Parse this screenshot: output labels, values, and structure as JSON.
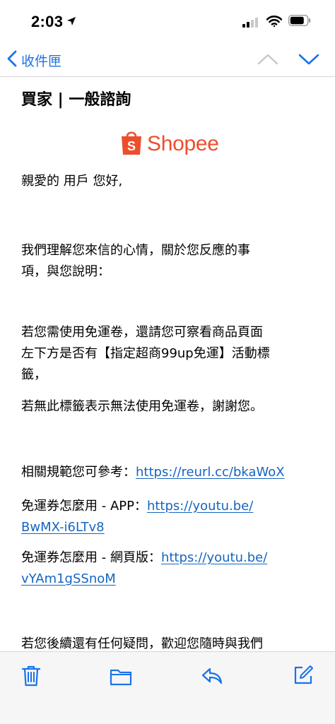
{
  "status_bar": {
    "time": "2:03"
  },
  "nav": {
    "back_label": "收件匣"
  },
  "email": {
    "subject": "買家 | 一般諮詢",
    "logo_text": "Shopee",
    "greeting": "親愛的 用戶 您好,",
    "para1_line1": "我們理解您來信的心情，關於您反應的事",
    "para1_line2": "項，與您說明：",
    "para2_line1": "若您需使用免運卷，還請您可察看商品頁面",
    "para2_line2": "左下方是否有【指定超商99up免運】活動標",
    "para2_line3": "籤，",
    "para3": "若無此標籤表示無法使用免運卷，謝謝您。",
    "ref_label": "相關規範您可參考：",
    "ref_link": "https://reurl.cc/bkaWoX",
    "app_label": "免運券怎麼用 - APP：",
    "app_link_part1": "https://youtu.be/",
    "app_link_part2": "BwMX-i6LTv8",
    "web_label": "免運券怎麼用 - 網頁版：",
    "web_link_part1": "https://youtu.be/",
    "web_link_part2": "vYAm1gSSnoM",
    "closing_line1": "若您後續還有任何疑問，歡迎您隨時與我們"
  },
  "colors": {
    "accent": "#1a73e8",
    "link": "#1565c0",
    "brand": "#ee4d2d"
  },
  "icons": {
    "status": [
      "location-arrow-icon",
      "cellular-signal-icon",
      "wifi-icon",
      "battery-icon"
    ],
    "nav": [
      "chevron-left-icon",
      "chevron-up-icon",
      "chevron-down-icon"
    ],
    "toolbar": [
      "trash-icon",
      "folder-icon",
      "reply-icon",
      "compose-icon"
    ]
  }
}
